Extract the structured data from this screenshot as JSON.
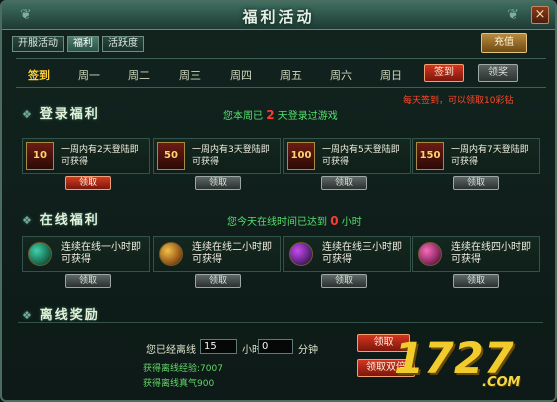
{
  "window": {
    "title": "福利活动",
    "close_label": "×",
    "recharge_label": "充值"
  },
  "tabs": [
    "开服活动",
    "福利",
    "活跃度"
  ],
  "days": {
    "items": [
      "签到",
      "周一",
      "周二",
      "周三",
      "周四",
      "周五",
      "周六",
      "周日"
    ],
    "active": 0,
    "signin_btn": "签到",
    "reward_btn": "领奖",
    "hint": "每天签到，可以领取10彩钻"
  },
  "login": {
    "title": "登录福利",
    "status": {
      "prefix": "您本周已",
      "value": "2",
      "suffix": "天登录过游戏"
    },
    "cards": [
      {
        "icon": "10",
        "text": "一周内有2天登陆即可获得",
        "button": "领取",
        "active": true
      },
      {
        "icon": "50",
        "text": "一周内有3天登陆即可获得",
        "button": "领取",
        "active": false
      },
      {
        "icon": "100",
        "text": "一周内有5天登陆即可获得",
        "button": "领取",
        "active": false
      },
      {
        "icon": "150",
        "text": "一周内有7天登陆即可获得",
        "button": "领取",
        "active": false
      }
    ]
  },
  "online": {
    "title": "在线福利",
    "status": {
      "prefix": "您今天在线时间已达到",
      "value": "0",
      "suffix": "小时"
    },
    "cards": [
      {
        "text": "连续在线一小时即可获得",
        "button": "领取",
        "colors": [
          "#40d1a8",
          "#135f47"
        ]
      },
      {
        "text": "连续在线二小时即可获得",
        "button": "领取",
        "colors": [
          "#f2c14a",
          "#8a4a10"
        ]
      },
      {
        "text": "连续在线三小时即可获得",
        "button": "领取",
        "colors": [
          "#c64cf0",
          "#4b1b6a"
        ]
      },
      {
        "text": "连续在线四小时即可获得",
        "button": "领取",
        "colors": [
          "#f76bb8",
          "#7a1f55"
        ]
      }
    ]
  },
  "offline": {
    "title": "离线奖励",
    "prefix": "您已经离线",
    "hours": "15",
    "hours_label": "小时",
    "minutes": "0",
    "minutes_label": "分钟",
    "exp_label": "获得离线经验:7007",
    "qi_label": "获得离线真气900",
    "claim_btn": "领取",
    "double_btn": "领取双倍"
  },
  "watermark": {
    "main": "1727",
    "sub": ".COM"
  }
}
